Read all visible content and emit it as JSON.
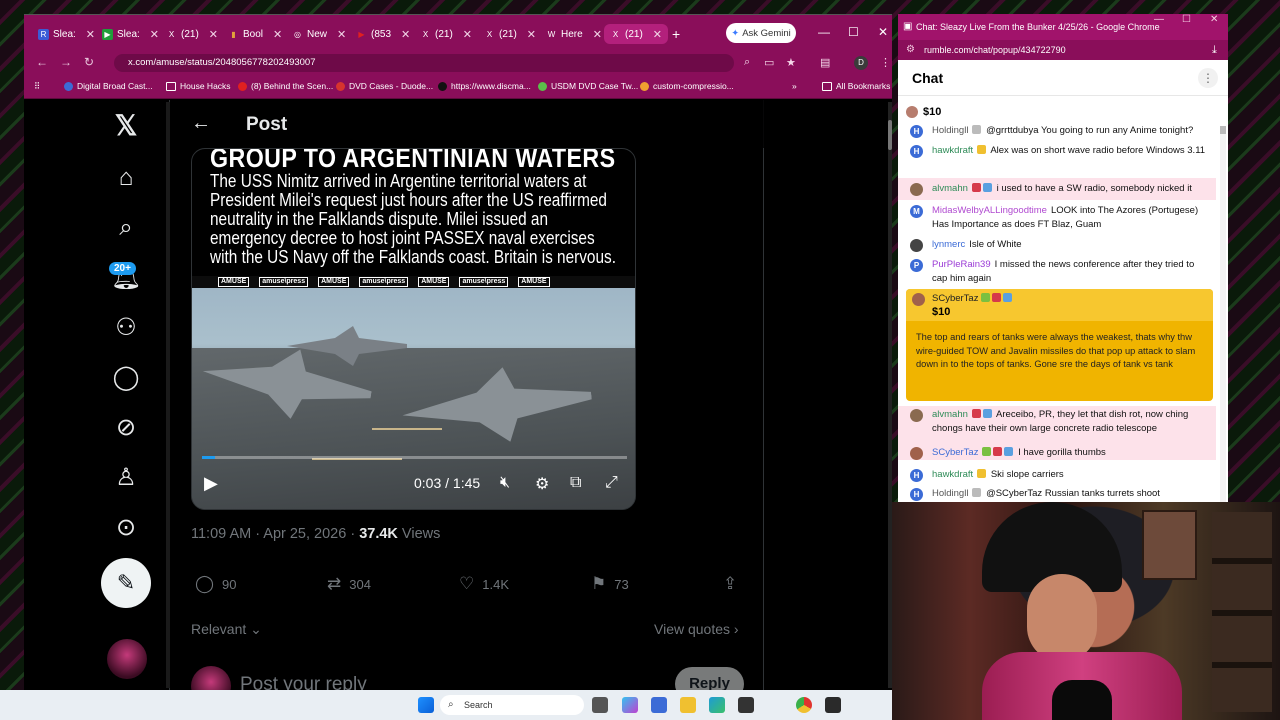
{
  "left_browser": {
    "tabs": [
      {
        "label": "Slea:",
        "fav": "R",
        "color": "#3b5cd6"
      },
      {
        "label": "Slea:",
        "fav": "▶",
        "color": "#1f9d3a"
      },
      {
        "label": "(21)",
        "fav": "X",
        "color": "#000000"
      },
      {
        "label": "Bool",
        "fav": "▮",
        "color": "#e2a23a"
      },
      {
        "label": "New",
        "fav": "◎",
        "color": "#444444"
      },
      {
        "label": "(853",
        "fav": "▶",
        "color": "#e02020"
      },
      {
        "label": "(21)",
        "fav": "X",
        "color": "#000000"
      },
      {
        "label": "(21)",
        "fav": "X",
        "color": "#000000"
      },
      {
        "label": "Here",
        "fav": "W",
        "color": "#666666"
      },
      {
        "label": "(21)",
        "fav": "X",
        "color": "#000000"
      }
    ],
    "new_tab": "+",
    "gemini_label": "Ask Gemini",
    "url": "x.com/amuse/status/2048056778202493007",
    "profile_letter": "D",
    "bookmarks": [
      "Digital Broad Cast...",
      "House Hacks",
      "(8) Behind the Scen...",
      "DVD Cases - Duode...",
      "https://www.discma...",
      "USDM DVD Case Tw...",
      "custom-compressio..."
    ],
    "all_bookmarks": "All Bookmarks"
  },
  "x_page": {
    "header_title": "Post",
    "notif_badge": "20+",
    "media": {
      "headline": "GROUP TO ARGENTINIAN WATERS",
      "body": "The USS Nimitz arrived in Argentine territorial waters at President Milei's request just hours after the US reaffirmed neutrality in the Falklands dispute. Milei issued an emergency decree to host joint PASSEX naval exercises with the US Navy off the Falklands coast. Britain is nervous.",
      "strip_labels": [
        "AMUSE",
        "amuse\\press",
        "AMUSE",
        "amuse\\press",
        "AMUSE",
        "amuse\\press",
        "AMUSE"
      ],
      "timecode": "0:03 / 1:45",
      "progress": 0.03
    },
    "timestamp": "11:09 AM · Apr 25, 2026 · ",
    "views_count": "37.4K",
    "views_label": " Views",
    "actions": {
      "replies": "90",
      "reposts": "304",
      "likes": "1.4K",
      "bookmarks": "73"
    },
    "relevant_label": "Relevant",
    "view_quotes_label": "View quotes",
    "reply_placeholder": "Post your reply",
    "reply_button": "Reply"
  },
  "chat_window": {
    "window_title": "Chat: Sleazy Live From the Bunker 4/25/26 - Google Chrome",
    "url": "rumble.com/chat/popup/434722790",
    "chat_title": "Chat",
    "pinned_amount": "$10",
    "messages": [
      {
        "user": "Holdingll",
        "text": "@grrttdubya You going to run any Anime tonight?",
        "user_color": "#555555",
        "av": "H",
        "av_color": "#3b6bd6"
      },
      {
        "user": "hawkdraft",
        "text": "Alex was on short wave radio before Windows 3.11",
        "user_color": "#2e8b57",
        "av": "H",
        "av_color": "#3b6bd6"
      },
      {
        "user": "alvmahn",
        "text": "i used to have a SW radio, somebody nicked it",
        "user_color": "#2e8b57",
        "av": "",
        "av_color": "#8a6a50"
      },
      {
        "user": "MidasWelbyALLingoodtime",
        "text": "LOOK into The Azores (Portugese) Has Importance as does FT Blaz, Guam",
        "user_color": "#b04ad0",
        "av": "M",
        "av_color": "#3b6bd6"
      },
      {
        "user": "lynmerc",
        "text": "Isle of White",
        "user_color": "#3b6bd6",
        "av": "",
        "av_color": "#444444"
      },
      {
        "user": "PurPleRain39",
        "text": "I missed the news conference after they tried to cap him again",
        "user_color": "#9b3bd6",
        "av": "P",
        "av_color": "#3b6bd6"
      },
      {
        "user": "alvmahn",
        "text": "Areceibo, PR, they let that dish rot, now ching chongs have their own large concrete radio telescope",
        "user_color": "#2e8b57",
        "av": "",
        "av_color": "#8a6a50"
      },
      {
        "user": "SCyberTaz",
        "text": "I have gorilla thumbs",
        "user_color": "#3b6bd6",
        "av": "",
        "av_color": "#a0614b"
      },
      {
        "user": "hawkdraft",
        "text": "Ski slope carriers",
        "user_color": "#2e8b57",
        "av": "H",
        "av_color": "#3b6bd6"
      },
      {
        "user": "Holdingll",
        "text": "@SCyberTaz Russian tanks turrets shoot",
        "user_color": "#555555",
        "av": "H",
        "av_color": "#3b6bd6"
      }
    ],
    "rant": {
      "user": "SCyberTaz",
      "amount": "$10",
      "text": "The top and rears of tanks were always the weakest, thats why thw wire-guided TOW and Javalin missiles do that pop up attack to slam down in to the tops of tanks. Gone sre the days of tank vs tank"
    }
  },
  "taskbar": {
    "search_label": "Search"
  }
}
